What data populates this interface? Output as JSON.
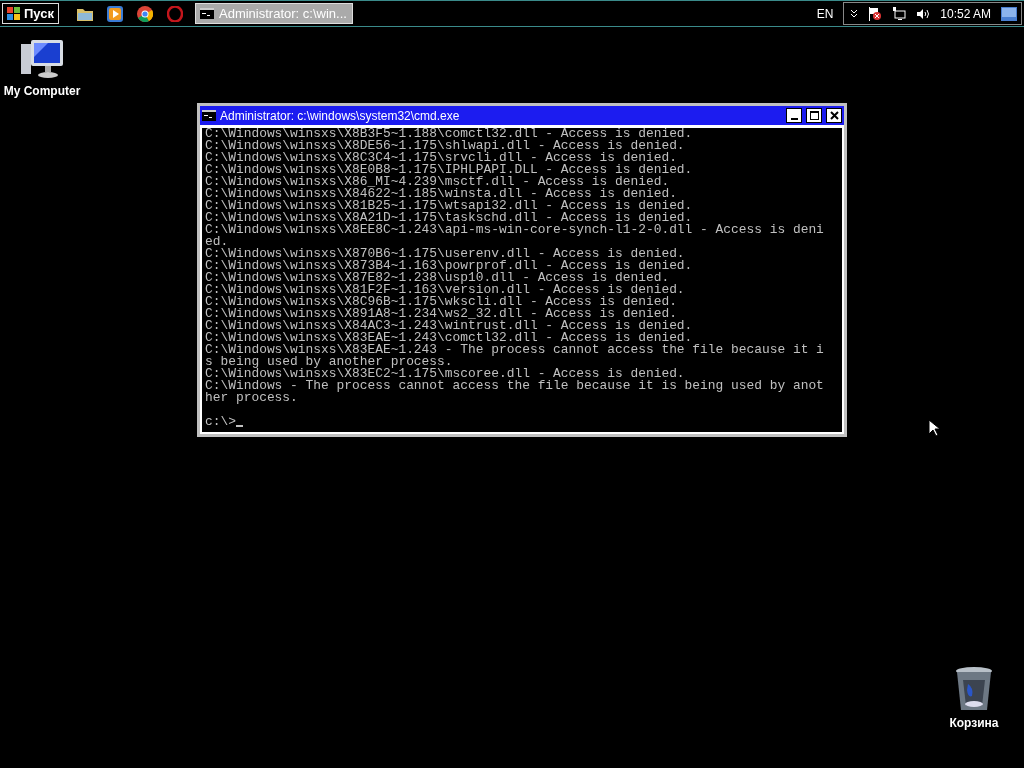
{
  "taskbar": {
    "start_label": "Пуск",
    "tasks": [
      {
        "title": "Administrator: c:\\win...",
        "selected": true
      }
    ],
    "language": "EN",
    "clock": "10:52 AM"
  },
  "desktop_icons": [
    {
      "kind": "computer",
      "label": "My Computer"
    },
    {
      "kind": "recycle",
      "label": "Корзина"
    }
  ],
  "window": {
    "title": "Administrator: c:\\windows\\system32\\cmd.exe",
    "lines": [
      "C:\\Windows\\winsxs\\X8B3F5~1.188\\comctl32.dll - Access is denied.",
      "C:\\Windows\\winsxs\\X8DE56~1.175\\shlwapi.dll - Access is denied.",
      "C:\\Windows\\winsxs\\X8C3C4~1.175\\srvcli.dll - Access is denied.",
      "C:\\Windows\\winsxs\\X8E0B8~1.175\\IPHLPAPI.DLL - Access is denied.",
      "C:\\Windows\\winsxs\\X86_MI~4.239\\msctf.dll - Access is denied.",
      "C:\\Windows\\winsxs\\X84622~1.185\\winsta.dll - Access is denied.",
      "C:\\Windows\\winsxs\\X81B25~1.175\\wtsapi32.dll - Access is denied.",
      "C:\\Windows\\winsxs\\X8A21D~1.175\\taskschd.dll - Access is denied.",
      "C:\\Windows\\winsxs\\X8EE8C~1.243\\api-ms-win-core-synch-l1-2-0.dll - Access is deni",
      "ed.",
      "C:\\Windows\\winsxs\\X870B6~1.175\\userenv.dll - Access is denied.",
      "C:\\Windows\\winsxs\\X873B4~1.163\\powrprof.dll - Access is denied.",
      "C:\\Windows\\winsxs\\X87E82~1.238\\usp10.dll - Access is denied.",
      "C:\\Windows\\winsxs\\X81F2F~1.163\\version.dll - Access is denied.",
      "C:\\Windows\\winsxs\\X8C96B~1.175\\wkscli.dll - Access is denied.",
      "C:\\Windows\\winsxs\\X891A8~1.234\\ws2_32.dll - Access is denied.",
      "C:\\Windows\\winsxs\\X84AC3~1.243\\wintrust.dll - Access is denied.",
      "C:\\Windows\\winsxs\\X83EAE~1.243\\comctl32.dll - Access is denied.",
      "C:\\Windows\\winsxs\\X83EAE~1.243 - The process cannot access the file because it i",
      "s being used by another process.",
      "C:\\Windows\\winsxs\\X83EC2~1.175\\mscoree.dll - Access is denied.",
      "C:\\Windows - The process cannot access the file because it is being used by anot",
      "her process."
    ],
    "prompt": "c:\\>"
  }
}
